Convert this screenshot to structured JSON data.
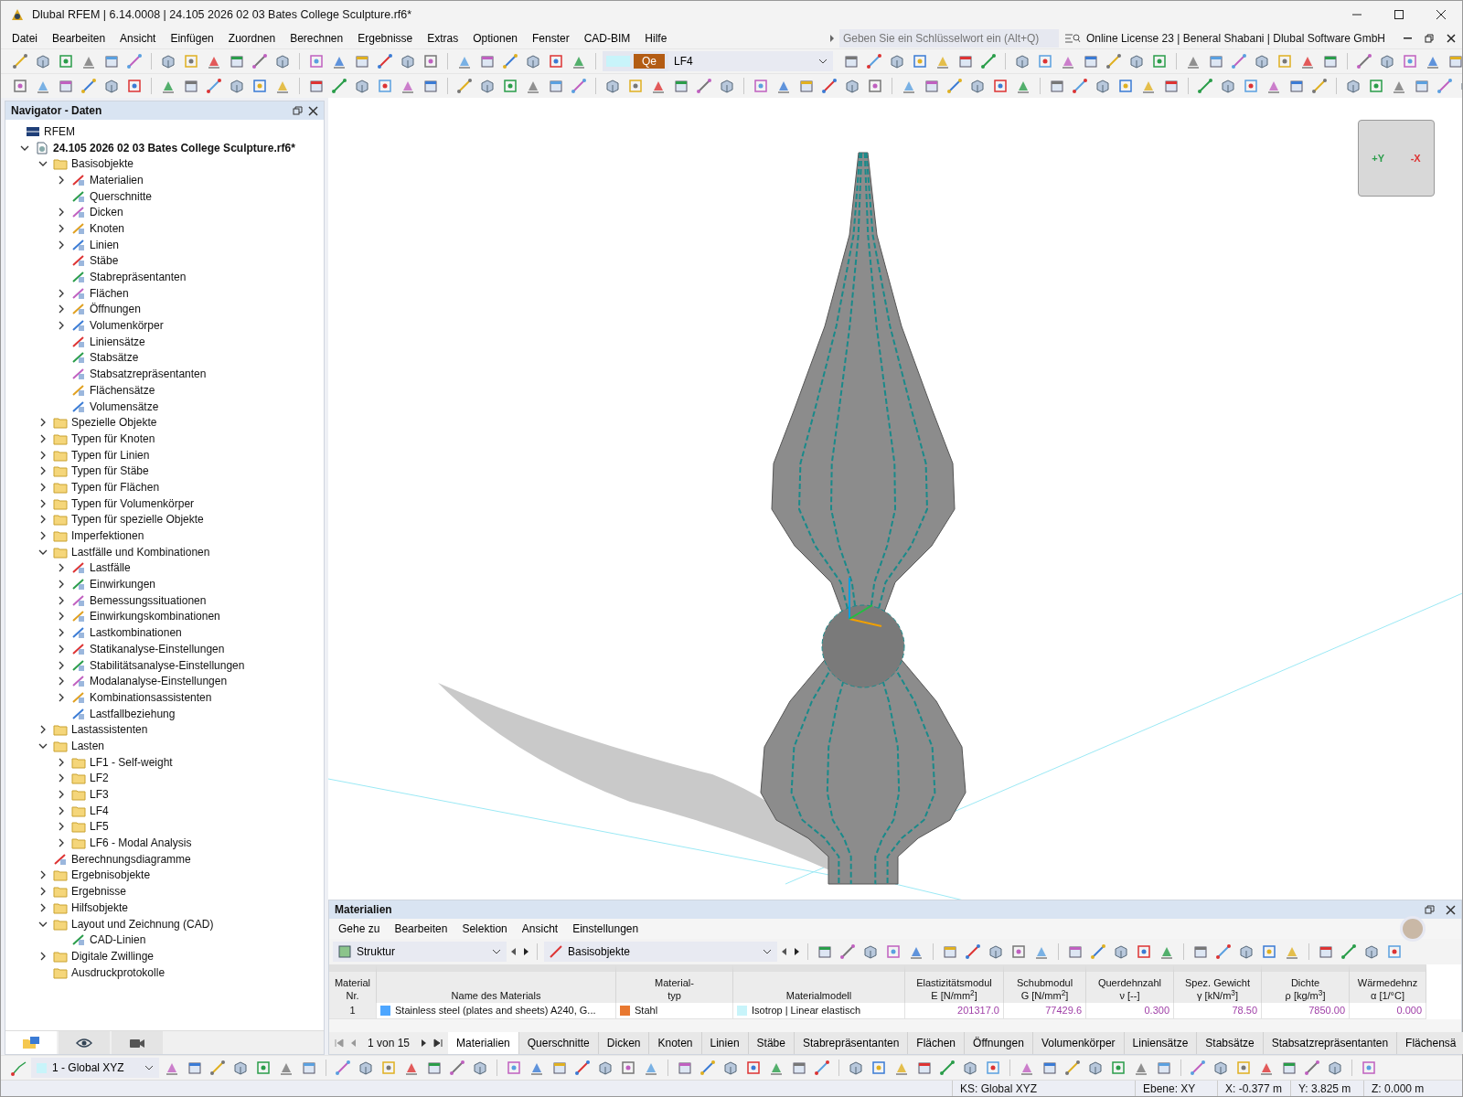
{
  "window": {
    "title": "Dlubal RFEM | 6.14.0008 | 24.105 2026 02 03 Bates College Sculpture.rf6*"
  },
  "menu": [
    "Datei",
    "Bearbeiten",
    "Ansicht",
    "Einfügen",
    "Zuordnen",
    "Berechnen",
    "Ergebnisse",
    "Extras",
    "Optionen",
    "Fenster",
    "CAD-BIM",
    "Hilfe"
  ],
  "search": {
    "placeholder": "Geben Sie ein Schlüsselwort ein (Alt+Q)"
  },
  "license": "Online License 23 | Beneral Shabani | Dlubal Software GmbH",
  "load_case": {
    "badge": "Qe",
    "value": "LF4"
  },
  "navigator": {
    "title": "Navigator - Daten",
    "tree": [
      {
        "label": "RFEM",
        "kind": "root",
        "children": [
          {
            "label": "24.105 2026 02 03 Bates College Sculpture.rf6*",
            "kind": "file",
            "expanded": true,
            "children": [
              {
                "label": "Basisobjekte",
                "kind": "folder",
                "expanded": true,
                "children": [
                  {
                    "label": "Materialien",
                    "kind": "object",
                    "expanded": false
                  },
                  {
                    "label": "Querschnitte",
                    "kind": "object"
                  },
                  {
                    "label": "Dicken",
                    "kind": "object",
                    "expanded": false
                  },
                  {
                    "label": "Knoten",
                    "kind": "object",
                    "expanded": false
                  },
                  {
                    "label": "Linien",
                    "kind": "object",
                    "expanded": false
                  },
                  {
                    "label": "Stäbe",
                    "kind": "object"
                  },
                  {
                    "label": "Stabrepräsentanten",
                    "kind": "object"
                  },
                  {
                    "label": "Flächen",
                    "kind": "object",
                    "expanded": false
                  },
                  {
                    "label": "Öffnungen",
                    "kind": "object",
                    "expanded": false
                  },
                  {
                    "label": "Volumenkörper",
                    "kind": "object",
                    "expanded": false
                  },
                  {
                    "label": "Liniensätze",
                    "kind": "object"
                  },
                  {
                    "label": "Stabsätze",
                    "kind": "object"
                  },
                  {
                    "label": "Stabsatzrepräsentanten",
                    "kind": "object"
                  },
                  {
                    "label": "Flächensätze",
                    "kind": "object"
                  },
                  {
                    "label": "Volumensätze",
                    "kind": "object"
                  }
                ]
              },
              {
                "label": "Spezielle Objekte",
                "kind": "folder",
                "expanded": false
              },
              {
                "label": "Typen für Knoten",
                "kind": "folder",
                "expanded": false
              },
              {
                "label": "Typen für Linien",
                "kind": "folder",
                "expanded": false
              },
              {
                "label": "Typen für Stäbe",
                "kind": "folder",
                "expanded": false
              },
              {
                "label": "Typen für Flächen",
                "kind": "folder",
                "expanded": false
              },
              {
                "label": "Typen für Volumenkörper",
                "kind": "folder",
                "expanded": false
              },
              {
                "label": "Typen für spezielle Objekte",
                "kind": "folder",
                "expanded": false
              },
              {
                "label": "Imperfektionen",
                "kind": "folder",
                "expanded": false
              },
              {
                "label": "Lastfälle und Kombinationen",
                "kind": "folder",
                "expanded": true,
                "children": [
                  {
                    "label": "Lastfälle",
                    "kind": "object",
                    "expanded": false
                  },
                  {
                    "label": "Einwirkungen",
                    "kind": "object",
                    "expanded": false
                  },
                  {
                    "label": "Bemessungssituationen",
                    "kind": "object",
                    "expanded": false
                  },
                  {
                    "label": "Einwirkungskombinationen",
                    "kind": "object",
                    "expanded": false
                  },
                  {
                    "label": "Lastkombinationen",
                    "kind": "object",
                    "expanded": false
                  },
                  {
                    "label": "Statikanalyse-Einstellungen",
                    "kind": "object",
                    "expanded": false
                  },
                  {
                    "label": "Stabilitätsanalyse-Einstellungen",
                    "kind": "object",
                    "expanded": false
                  },
                  {
                    "label": "Modalanalyse-Einstellungen",
                    "kind": "object",
                    "expanded": false
                  },
                  {
                    "label": "Kombinationsassistenten",
                    "kind": "object",
                    "expanded": false
                  },
                  {
                    "label": "Lastfallbeziehung",
                    "kind": "object"
                  }
                ]
              },
              {
                "label": "Lastassistenten",
                "kind": "folder",
                "expanded": false
              },
              {
                "label": "Lasten",
                "kind": "folder",
                "expanded": true,
                "children": [
                  {
                    "label": "LF1 - Self-weight",
                    "kind": "folder",
                    "expanded": false
                  },
                  {
                    "label": "LF2",
                    "kind": "folder",
                    "expanded": false
                  },
                  {
                    "label": "LF3",
                    "kind": "folder",
                    "expanded": false
                  },
                  {
                    "label": "LF4",
                    "kind": "folder",
                    "expanded": false
                  },
                  {
                    "label": "LF5",
                    "kind": "folder",
                    "expanded": false
                  },
                  {
                    "label": "LF6 - Modal Analysis",
                    "kind": "folder",
                    "expanded": false
                  }
                ]
              },
              {
                "label": "Berechnungsdiagramme",
                "kind": "object"
              },
              {
                "label": "Ergebnisobjekte",
                "kind": "folder",
                "expanded": false
              },
              {
                "label": "Ergebnisse",
                "kind": "folder",
                "expanded": false
              },
              {
                "label": "Hilfsobjekte",
                "kind": "folder",
                "expanded": false
              },
              {
                "label": "Layout und Zeichnung (CAD)",
                "kind": "folder",
                "expanded": true,
                "children": [
                  {
                    "label": "CAD-Linien",
                    "kind": "object"
                  }
                ]
              },
              {
                "label": "Digitale Zwillinge",
                "kind": "folder",
                "expanded": false
              },
              {
                "label": "Ausdruckprotokolle",
                "kind": "folder"
              }
            ]
          }
        ]
      }
    ],
    "tabs": [
      {
        "kind": "data",
        "selected": true
      },
      {
        "kind": "view",
        "selected": false
      },
      {
        "kind": "camera",
        "selected": false
      }
    ]
  },
  "table_panel": {
    "title": "Materialien",
    "menu": [
      "Gehe zu",
      "Bearbeiten",
      "Selektion",
      "Ansicht",
      "Einstellungen"
    ],
    "filters": [
      "Struktur",
      "Basisobjekte"
    ],
    "columns": [
      {
        "lines": [
          "Material",
          "Nr."
        ]
      },
      {
        "lines": [
          "Name des Materials"
        ]
      },
      {
        "lines": [
          "Material-",
          "typ"
        ]
      },
      {
        "lines": [
          "Materialmodell"
        ]
      },
      {
        "lines": [
          "Elastizitätsmodul",
          "E [N/mm$^{2}$]"
        ]
      },
      {
        "lines": [
          "Schubmodul",
          "G [N/mm$^{2}$]"
        ]
      },
      {
        "lines": [
          "Querdehnzahl",
          "ν [--]"
        ]
      },
      {
        "lines": [
          "Spez. Gewicht",
          "γ [kN/m$^{3}$]"
        ]
      },
      {
        "lines": [
          "Dichte",
          "ρ [kg/m$^{3}$]"
        ]
      },
      {
        "lines": [
          "Wärmedehnz",
          "α [1/°C]"
        ]
      }
    ],
    "rows": [
      [
        {
          "text": "1"
        },
        {
          "text": "Stainless steel (plates and sheets) A240, G...",
          "color": "#4da6ff"
        },
        {
          "text": "Stahl",
          "color": "#e87830"
        },
        {
          "text": "Isotrop | Linear elastisch",
          "color": "#c8f4fa"
        },
        {
          "text": "201317.0"
        },
        {
          "text": "77429.6"
        },
        {
          "text": "0.300"
        },
        {
          "text": "78.50"
        },
        {
          "text": "7850.00"
        },
        {
          "text": "0.000"
        }
      ]
    ],
    "pager": "1 von 15",
    "tabs": [
      {
        "label": "Materialien",
        "selected": true
      },
      {
        "label": "Querschnitte",
        "selected": false
      },
      {
        "label": "Dicken",
        "selected": false
      },
      {
        "label": "Knoten",
        "selected": false
      },
      {
        "label": "Linien",
        "selected": false
      },
      {
        "label": "Stäbe",
        "selected": false
      },
      {
        "label": "Stabrepräsentanten",
        "selected": false
      },
      {
        "label": "Flächen",
        "selected": false
      },
      {
        "label": "Öffnungen",
        "selected": false
      },
      {
        "label": "Volumenkörper",
        "selected": false
      },
      {
        "label": "Liniensätze",
        "selected": false
      },
      {
        "label": "Stabsätze",
        "selected": false
      },
      {
        "label": "Stabsatzrepräsentanten",
        "selected": false
      },
      {
        "label": "Flächensä",
        "selected": false
      }
    ]
  },
  "coordinate_system": {
    "value": "1 - Global XYZ",
    "color": "#c8f4fa"
  },
  "view_cube": {
    "faces": [
      "+Y",
      "-X"
    ]
  },
  "status_bar": [
    "KS: Global XYZ",
    "Ebene: XY",
    "X: -0.377 m",
    "Y: 3.825 m",
    "Z: 0.000 m"
  ]
}
